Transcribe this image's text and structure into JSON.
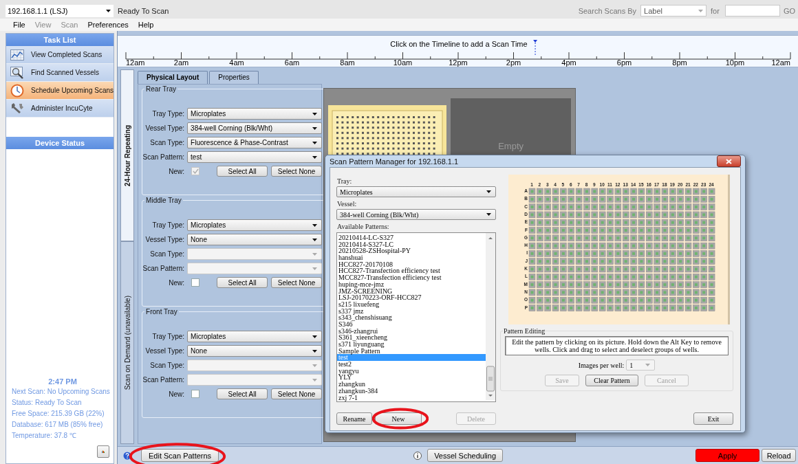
{
  "connection": {
    "value": "192.168.1.1 (LSJ)"
  },
  "status_text": "Ready To Scan",
  "search": {
    "label": "Search Scans By",
    "by": "Label",
    "for_label": "for",
    "go": "GO"
  },
  "menu": [
    {
      "label": "File",
      "disabled": false
    },
    {
      "label": "View",
      "disabled": true
    },
    {
      "label": "Scan",
      "disabled": true
    },
    {
      "label": "Preferences",
      "disabled": false
    },
    {
      "label": "Help",
      "disabled": false
    }
  ],
  "task_list": {
    "title": "Task List",
    "items": [
      {
        "label": "View Completed Scans",
        "kind": "chart",
        "selected": false
      },
      {
        "label": "Find Scanned Vessels",
        "kind": "magnifier",
        "selected": false
      },
      {
        "label": "Schedule Upcoming Scans",
        "kind": "clock",
        "selected": true
      },
      {
        "label": "Administer IncuCyte",
        "kind": "wrench",
        "selected": false
      }
    ]
  },
  "device_status": {
    "title": "Device Status",
    "time": "2:47 PM",
    "lines": [
      "Next Scan: No Upcoming Scans",
      "Status: Ready To Scan",
      "Free Space: 215.39 GB (22%)",
      "Database: 617 MB (85% free)",
      "Temperature: 37.8 ℃"
    ]
  },
  "timeline": {
    "hint": "Click on the Timeline to add a Scan Time",
    "labels": [
      "12am",
      "2am",
      "4am",
      "6am",
      "8am",
      "10am",
      "12pm",
      "2pm",
      "4pm",
      "6pm",
      "8pm",
      "10pm",
      "12am"
    ],
    "now_marker": {
      "level": 0.616
    }
  },
  "schedule_tabs": [
    {
      "label": "24-Hour Repeating",
      "selected": true
    },
    {
      "label": "Scan on Demand (unavailable)",
      "selected": false
    }
  ],
  "layout_tabs": [
    {
      "label": "Physical Layout",
      "selected": true
    },
    {
      "label": "Properties",
      "selected": false
    }
  ],
  "trays": [
    {
      "title": "Rear Tray",
      "fields": [
        {
          "label": "Tray Type:",
          "value": "Microplates",
          "disabled": false
        },
        {
          "label": "Vessel Type:",
          "value": "384-well Corning (Blk/Wht)",
          "disabled": false
        },
        {
          "label": "Scan Type:",
          "value": "Fluorescence & Phase-Contrast",
          "disabled": false
        },
        {
          "label": "Scan Pattern:",
          "value": "test",
          "disabled": false
        }
      ],
      "new_label": "New:",
      "new_checked": true,
      "new_disabled": true,
      "buttons": [
        "Select All",
        "Select None"
      ]
    },
    {
      "title": "Middle Tray",
      "fields": [
        {
          "label": "Tray Type:",
          "value": "Microplates",
          "disabled": false
        },
        {
          "label": "Vessel Type:",
          "value": "None",
          "disabled": false
        },
        {
          "label": "Scan Type:",
          "disabled": true
        },
        {
          "label": "Scan Pattern:",
          "disabled": true
        }
      ],
      "new_label": "New:",
      "new_checked": false,
      "new_disabled": false,
      "buttons": [
        "Select All",
        "Select None"
      ]
    },
    {
      "title": "Front Tray",
      "fields": [
        {
          "label": "Tray Type:",
          "value": "Microplates",
          "disabled": false
        },
        {
          "label": "Vessel Type:",
          "value": "None",
          "disabled": false
        },
        {
          "label": "Scan Type:",
          "disabled": true
        },
        {
          "label": "Scan Pattern:",
          "disabled": true
        }
      ],
      "new_label": "New:",
      "new_checked": false,
      "new_disabled": false,
      "buttons": [
        "Select All",
        "Select None"
      ]
    }
  ],
  "vessel_view": {
    "empty_label": "Empty"
  },
  "dialog": {
    "title": "Scan Pattern Manager for 192.168.1.1",
    "tray_label": "Tray:",
    "tray": "Microplates",
    "vessel_label": "Vessel:",
    "vessel": "384-well Corning (Blk/Wht)",
    "patterns_label": "Available Patterns:",
    "patterns": [
      {
        "label": "20210414-LC-S327",
        "selected": false
      },
      {
        "label": "20210414-S327-LC",
        "selected": false
      },
      {
        "label": "20210528-ZSHospital-PY",
        "selected": false
      },
      {
        "label": "hanshuai",
        "selected": false
      },
      {
        "label": "HCC827-20170108",
        "selected": false
      },
      {
        "label": "HCC827-Transfection efficiency test",
        "selected": false
      },
      {
        "label": "MCC827-Transfection efficiency test",
        "selected": false
      },
      {
        "label": "huping-mce-jmz",
        "selected": false
      },
      {
        "label": "JMZ-SCREENING",
        "selected": false
      },
      {
        "label": "LSJ-20170223-ORF-HCC827",
        "selected": false
      },
      {
        "label": "s215 lixuefeng",
        "selected": false
      },
      {
        "label": "s337 jmz",
        "selected": false
      },
      {
        "label": "s343_chenshisuang",
        "selected": false
      },
      {
        "label": "S346",
        "selected": false
      },
      {
        "label": "s346-zhangrui",
        "selected": false
      },
      {
        "label": "S361_xieencheng",
        "selected": false
      },
      {
        "label": "s371 liyunguang",
        "selected": false
      },
      {
        "label": "Sample Pattern",
        "selected": false
      },
      {
        "label": "test",
        "selected": true
      },
      {
        "label": "test2",
        "selected": false
      },
      {
        "label": "yangyu",
        "selected": false
      },
      {
        "label": "YLY",
        "selected": false
      },
      {
        "label": "zhangkun",
        "selected": false
      },
      {
        "label": "zhangkun-384",
        "selected": false
      },
      {
        "label": "zxj 7-1",
        "selected": false
      }
    ],
    "buttons": [
      {
        "label": "Rename",
        "disabled": false,
        "highlighted": false
      },
      {
        "label": "New",
        "disabled": false,
        "highlighted": true
      },
      {
        "label": "Delete",
        "disabled": true,
        "highlighted": false
      }
    ],
    "plate": {
      "columns": [
        "1",
        "2",
        "3",
        "4",
        "5",
        "6",
        "7",
        "8",
        "9",
        "10",
        "11",
        "12",
        "13",
        "14",
        "15",
        "16",
        "17",
        "18",
        "19",
        "20",
        "21",
        "22",
        "23",
        "24"
      ],
      "rows": [
        "A",
        "B",
        "C",
        "D",
        "E",
        "F",
        "G",
        "H",
        "I",
        "J",
        "K",
        "L",
        "M",
        "N",
        "O",
        "P"
      ],
      "wells_selected": true
    },
    "editing": {
      "title": "Pattern Editing",
      "help": "Edit the pattern by clicking on its picture. Hold down the Alt Key to remove wells. Click and drag to select and deselect groups of wells.",
      "images_label": "Images per well:",
      "images_value": "1",
      "images_disabled": true,
      "buttons": [
        {
          "label": "Save",
          "disabled": true
        },
        {
          "label": "Clear Pattern",
          "disabled": false
        },
        {
          "label": "Cancel",
          "disabled": true
        }
      ]
    },
    "exit": "Exit"
  },
  "bottom_bar": {
    "edit_button": {
      "label": "Edit Scan Patterns",
      "highlighted": true
    },
    "vessel_button": "Vessel Scheduling",
    "apply": "Apply",
    "reload": "Reload"
  }
}
